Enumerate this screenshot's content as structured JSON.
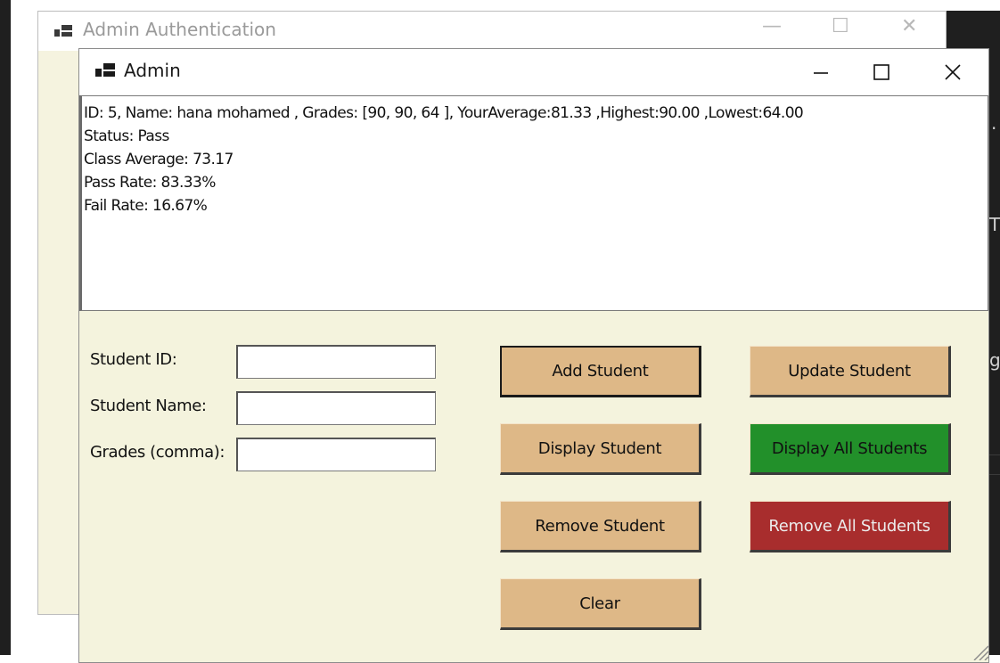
{
  "background_window": {
    "title": "Admin Authentication"
  },
  "window": {
    "title": "Admin"
  },
  "output": {
    "lines": [
      "ID: 5, Name: hana mohamed , Grades: [90, 90, 64 ], YourAverage:81.33 ,Highest:90.00 ,Lowest:64.00",
      "Status: Pass",
      "Class Average: 73.17",
      "Pass Rate: 83.33%",
      "Fail Rate: 16.67%"
    ]
  },
  "form": {
    "student_id_label": "Student ID:",
    "student_id_value": "",
    "student_name_label": "Student Name:",
    "student_name_value": "",
    "grades_label": "Grades (comma):",
    "grades_value": ""
  },
  "buttons": {
    "add": "Add Student",
    "update": "Update Student",
    "display": "Display Student",
    "display_all": "Display All Students",
    "remove": "Remove Student",
    "remove_all": "Remove All Students",
    "clear": "Clear"
  },
  "edge_text": {
    "t": "T",
    "g": "g",
    "dot": "."
  },
  "colors": {
    "button_tan": "#deb887",
    "button_green": "#22902a",
    "button_red": "#a82d2d",
    "form_background": "#f4f3dd"
  }
}
